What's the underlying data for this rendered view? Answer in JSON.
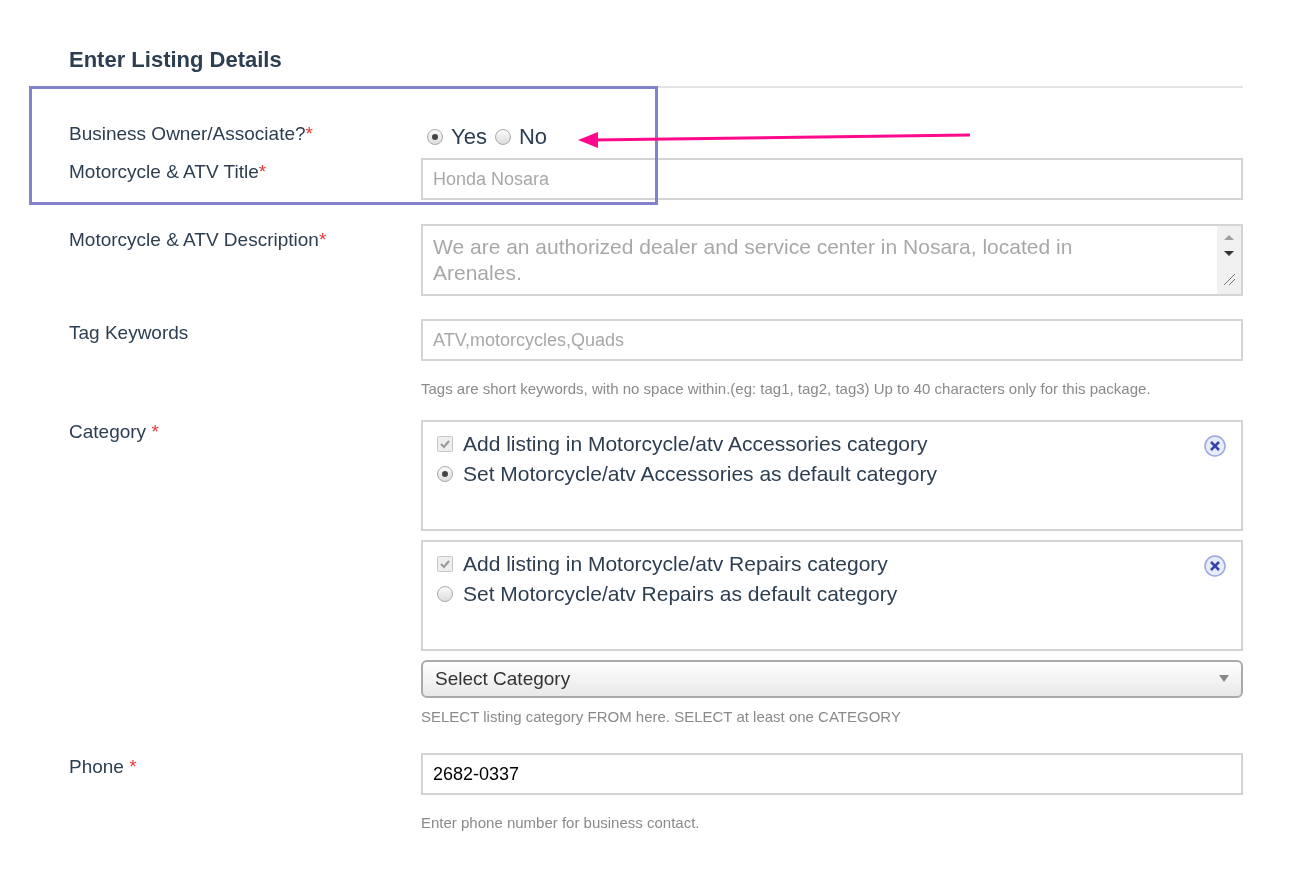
{
  "heading": "Enter Listing Details",
  "fields": [
    {
      "kind": "radio",
      "label": "Business Owner/Associate?",
      "mark": "*",
      "options": [
        {
          "label": "Yes",
          "selected": true
        },
        {
          "label": "No",
          "selected": false
        }
      ]
    },
    {
      "kind": "text",
      "label": "Motorcycle & ATV Title",
      "mark": "*",
      "placeholder": "Honda Nosara"
    },
    {
      "kind": "textarea",
      "label": "Motorcycle & ATV Description",
      "mark": "*",
      "placeholder": "We are an authorized dealer and service center in Nosara, located in Arenales."
    },
    {
      "kind": "text",
      "label": "Tag Keywords",
      "placeholder": "ATV,motorcycles,Quads",
      "help": "Tags are short keywords, with no space within.(eg: tag1, tag2, tag3) Up to 40 characters only for this package."
    },
    {
      "kind": "category",
      "label": "Category",
      "mark": "*",
      "categories": [
        {
          "add_label": "Add listing in Motorcycle/atv Accessories category",
          "checked": true,
          "default_label": "Set Motorcycle/atv Accessories as default category",
          "selected": true
        },
        {
          "add_label": "Add listing in Motorcycle/atv Repairs category",
          "checked": true,
          "default_label": "Set Motorcycle/atv Repairs as default category",
          "selected": false
        }
      ],
      "select": "Select Category",
      "help": "SELECT listing category FROM here. SELECT at least one CATEGORY"
    },
    {
      "kind": "text",
      "label": "Phone",
      "mark": "*",
      "value": "2682-0337",
      "help": "Enter phone number for business contact."
    }
  ]
}
